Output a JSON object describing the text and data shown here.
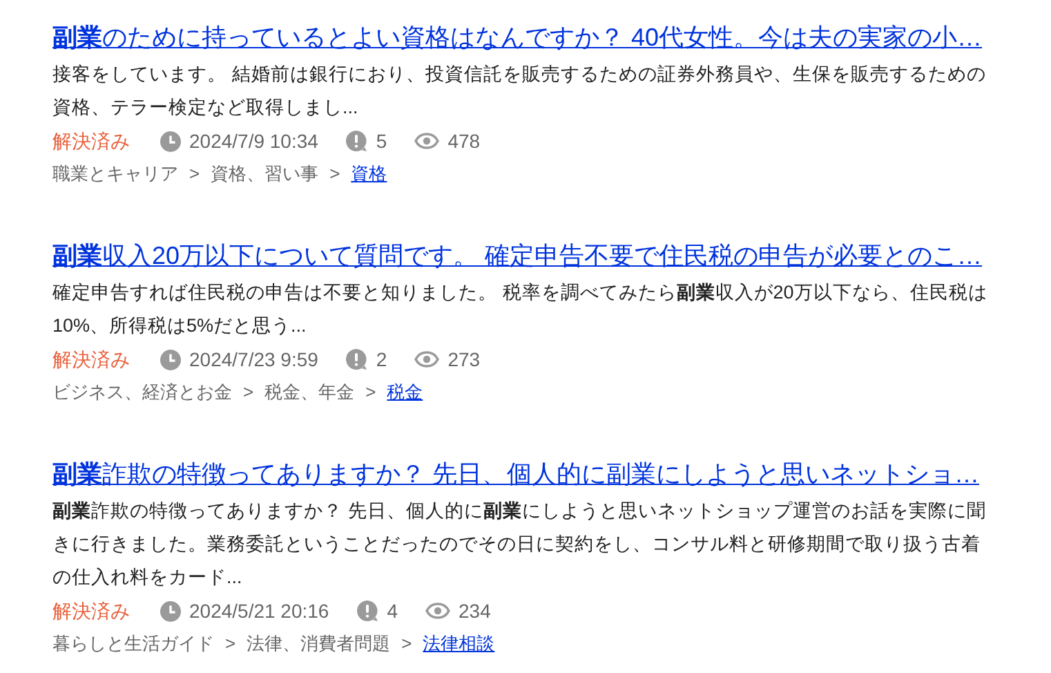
{
  "results": [
    {
      "title": "**副業**のために持っているとよい資格はなんですか？ 40代女性。今は夫の実家の小…",
      "snippet": "接客をしています。 結婚前は銀行におり、投資信託を販売するための証券外務員や、生保を販売するための資格、テラー検定など取得しまし...",
      "status": "解決済み",
      "date": "2024/7/9 10:34",
      "answers": "5",
      "views": "478",
      "breadcrumb": [
        {
          "kind": "text",
          "label": "職業とキャリア"
        },
        {
          "kind": "separator",
          "label": ">"
        },
        {
          "kind": "text",
          "label": "資格、習い事"
        },
        {
          "kind": "separator",
          "label": ">"
        },
        {
          "kind": "link",
          "label": "資格"
        }
      ]
    },
    {
      "title": "**副業**収入20万以下について質問です。 確定申告不要で住民税の申告が必要とのこ…",
      "snippet": "確定申告すれば住民税の申告は不要と知りました。 税率を調べてみたら**副業**収入が20万以下なら、住民税は10%、所得税は5%だと思う...",
      "status": "解決済み",
      "date": "2024/7/23 9:59",
      "answers": "2",
      "views": "273",
      "breadcrumb": [
        {
          "kind": "text",
          "label": "ビジネス、経済とお金"
        },
        {
          "kind": "separator",
          "label": ">"
        },
        {
          "kind": "text",
          "label": "税金、年金"
        },
        {
          "kind": "separator",
          "label": ">"
        },
        {
          "kind": "link",
          "label": "税金"
        }
      ]
    },
    {
      "title": "**副業**詐欺の特徴ってありますか？ 先日、個人的に副業にしようと思いネットショ…",
      "snippet": "**副業**詐欺の特徴ってありますか？ 先日、個人的に**副業**にしようと思いネットショップ運営のお話を実際に聞きに行きました。業務委託ということだったのでその日に契約をし、コンサル料と研修期間で取り扱う古着の仕入れ料をカード...",
      "status": "解決済み",
      "date": "2024/5/21 20:16",
      "answers": "4",
      "views": "234",
      "breadcrumb": [
        {
          "kind": "text",
          "label": "暮らしと生活ガイド"
        },
        {
          "kind": "separator",
          "label": ">"
        },
        {
          "kind": "text",
          "label": "法律、消費者問題"
        },
        {
          "kind": "separator",
          "label": ">"
        },
        {
          "kind": "link",
          "label": "法律相談"
        }
      ]
    }
  ]
}
